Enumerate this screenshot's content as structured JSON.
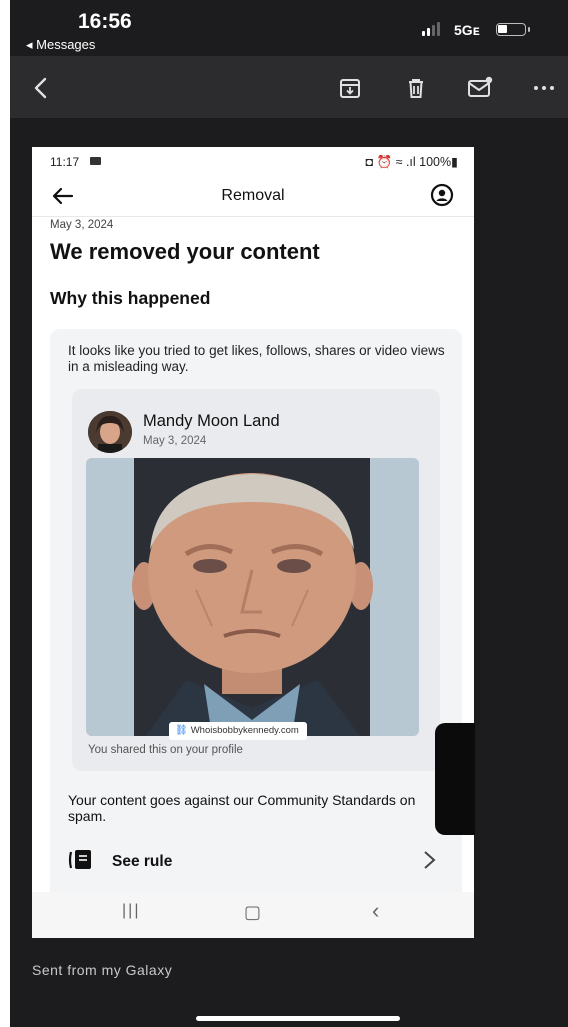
{
  "ios_status": {
    "time": "16:56",
    "back_app": "◂ Messages",
    "network": "5Gᴇ"
  },
  "mail_toolbar": {
    "icons": [
      "back-chevron-icon",
      "archive-icon",
      "trash-icon",
      "mail-unread-icon",
      "more-icon"
    ]
  },
  "screenshot": {
    "status": {
      "time": "11:17",
      "right": "◘ ⏰ ≈ .ıl 100%▮"
    },
    "header_title": "Removal",
    "date": "May 3, 2024",
    "heading": "We removed your content",
    "subheading": "Why this happened",
    "explanation": "It looks like you tried to get likes, follows, shares or video views in a misleading way.",
    "post": {
      "author": "Mandy Moon Land",
      "date": "May 3, 2024",
      "link_text": "Whoisbobbykennedy.com",
      "shared_note": "You shared this on your profile"
    },
    "standards_text": "Your content goes against our Community Standards on spam.",
    "rule_label": "See rule",
    "nav": {
      "recents": "|||",
      "home": "▢",
      "back": "‹"
    }
  },
  "footer": {
    "signature": "Sent from my Galaxy"
  },
  "colors": {
    "dark_bg": "#1c1c1e",
    "toolbar_bg": "#2c2c2e",
    "fb_blue": "#1877f2"
  }
}
